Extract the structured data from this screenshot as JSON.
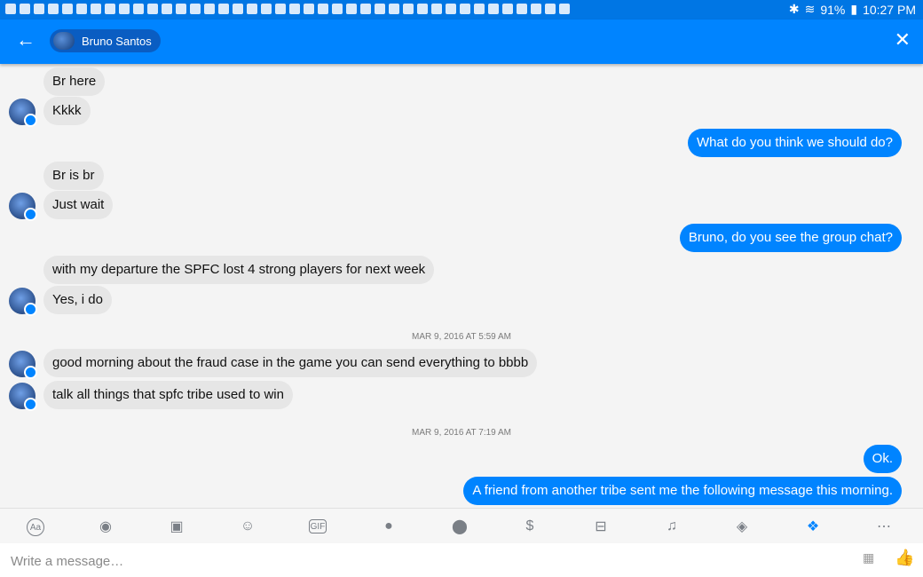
{
  "status_bar": {
    "battery": "91%",
    "time": "10:27 PM"
  },
  "header": {
    "contact_name": "Bruno Santos",
    "back_icon": "arrow-left-icon",
    "close_icon": "close-icon"
  },
  "messages": [
    {
      "type": "in",
      "text": "Br here"
    },
    {
      "type": "in",
      "text": "Kkkk"
    },
    {
      "type": "out",
      "text": "What do you think we should do?"
    },
    {
      "type": "in",
      "text": "Br is br"
    },
    {
      "type": "in",
      "text": "Just wait"
    },
    {
      "type": "out",
      "text": "Bruno, do you see the group chat?"
    },
    {
      "type": "in",
      "text": "with my departure the SPFC lost 4 strong players for next week"
    },
    {
      "type": "in",
      "text": "Yes, i do"
    },
    {
      "type": "timestamp",
      "text": "MAR 9, 2016 AT 5:59 AM"
    },
    {
      "type": "in",
      "text": "good morning about the fraud case in the game you can send everything to bbbb"
    },
    {
      "type": "in",
      "text": "talk all things that spfc tribe used to win"
    },
    {
      "type": "timestamp",
      "text": "MAR 9, 2016 AT 7:19 AM"
    },
    {
      "type": "out",
      "text": "Ok."
    },
    {
      "type": "out",
      "text": "A friend from another tribe sent me the following message  this morning."
    }
  ],
  "toolbar": {
    "icons": [
      "text-aa-icon",
      "camera-icon",
      "image-icon",
      "emoji-icon",
      "gif-icon",
      "microphone-icon",
      "location-icon",
      "payment-icon",
      "car-icon",
      "bell-icon",
      "game-icon",
      "dropbox-icon",
      "more-icon"
    ],
    "labels": {
      "aa": "Aa",
      "gif": "GIF"
    }
  },
  "composer": {
    "placeholder": "Write a message…"
  },
  "colors": {
    "brand": "#0084ff",
    "incoming_bubble": "#e6e6e6",
    "outgoing_bubble": "#0084ff",
    "background": "#f4f4f4"
  }
}
